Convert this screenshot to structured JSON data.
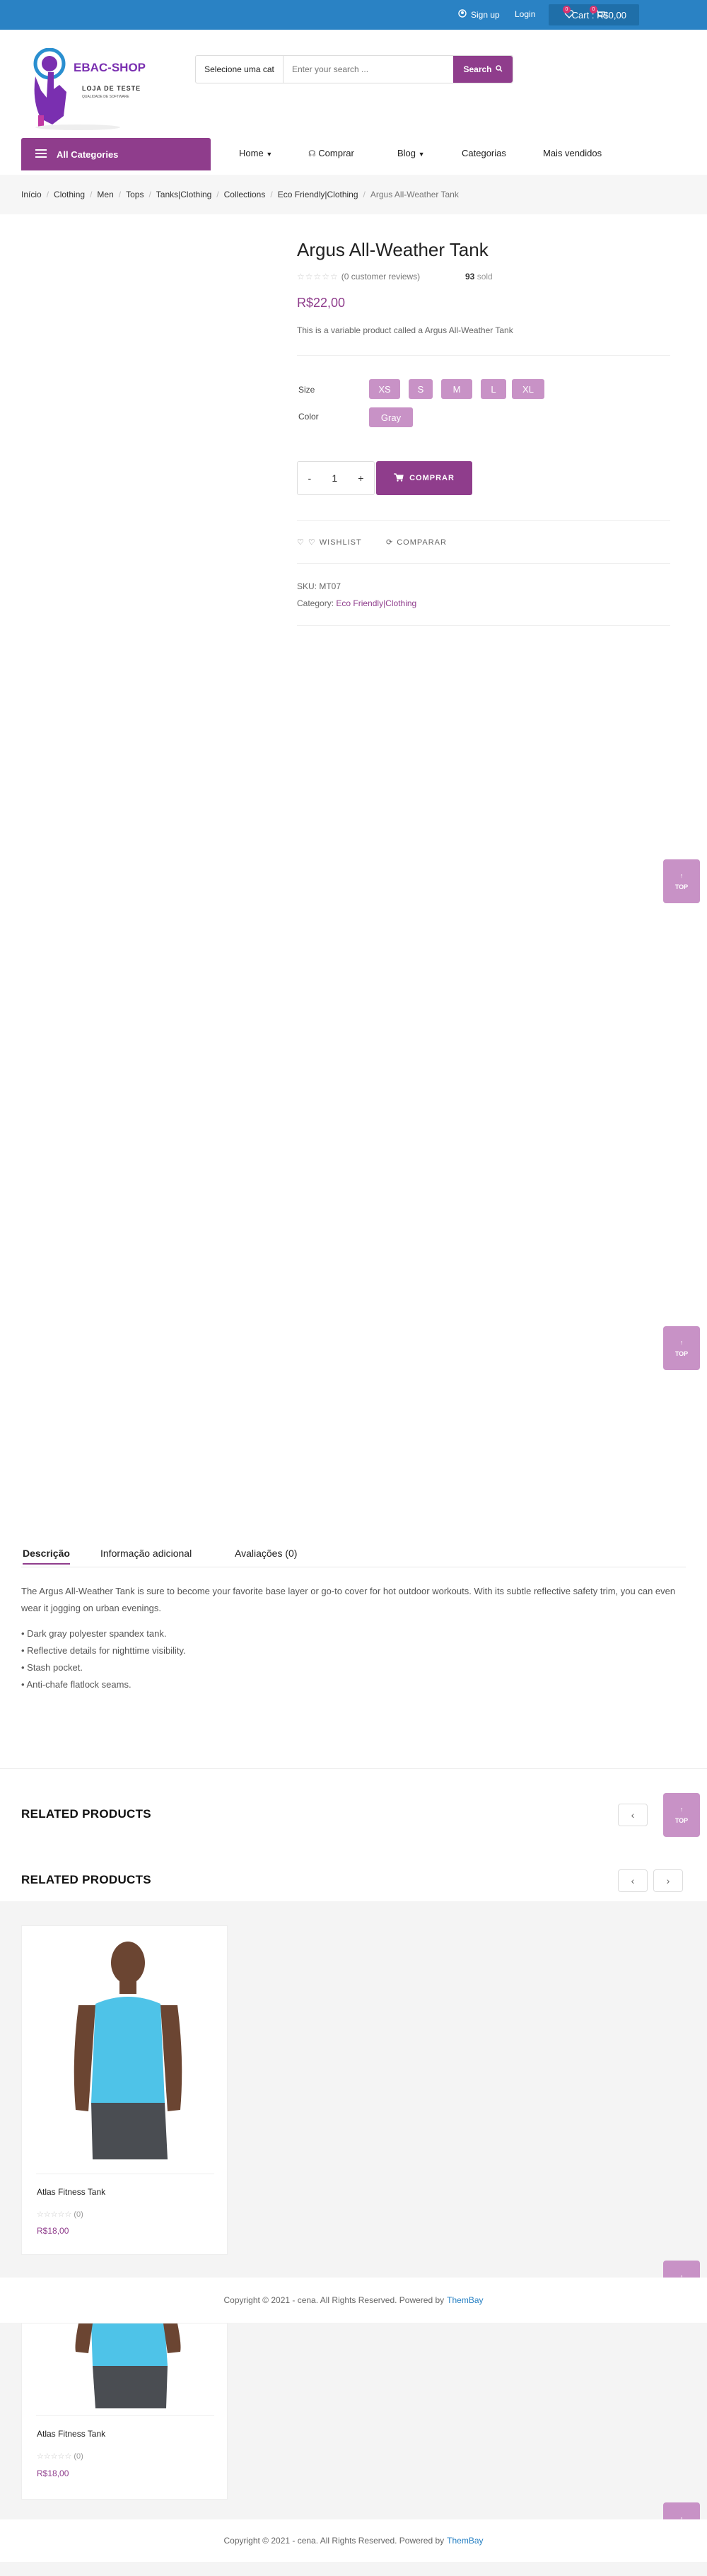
{
  "topbar": {
    "signup": "Sign up",
    "login": "Login",
    "cart_label": "Cart : R$0,00",
    "wishlist_count": "0",
    "cart_count": "0"
  },
  "logo": {
    "brand": "EBAC-SHOP",
    "tagline": "LOJA DE TESTE",
    "subtagline": "QUALIDADE DE SOFTWARE"
  },
  "search": {
    "category": "Selecione uma cat",
    "placeholder": "Enter your search ...",
    "button": "Search"
  },
  "nav": {
    "all_categories": "All Categories",
    "items": [
      "Home",
      "Comprar",
      "Blog",
      "Categorias",
      "Mais vendidos"
    ]
  },
  "breadcrumb": [
    "Início",
    "Clothing",
    "Men",
    "Tops",
    "Tanks|Clothing",
    "Collections",
    "Eco Friendly|Clothing",
    "Argus All-Weather Tank"
  ],
  "product": {
    "title": "Argus All-Weather Tank",
    "reviews": "(0 customer reviews)",
    "sold_count": "93",
    "sold_label": "sold",
    "price": "R$22,00",
    "short_description": "This is a variable product called a Argus All-Weather Tank",
    "size_label": "Size",
    "sizes": [
      "XS",
      "S",
      "M",
      "L",
      "XL"
    ],
    "color_label": "Color",
    "colors": [
      "Gray"
    ],
    "quantity": "1",
    "buy_button": "COMPRAR",
    "wishlist": "WISHLIST",
    "compare": "COMPARAR",
    "sku_label": "SKU:",
    "sku": "MT07",
    "category_label": "Category:",
    "category": "Eco Friendly|Clothing"
  },
  "totop_label": "TOP",
  "tabs": [
    "Descrição",
    "Informação adicional",
    "Avaliações (0)"
  ],
  "description": {
    "text": "The Argus All-Weather Tank is sure to become your favorite base layer or go-to cover for hot outdoor workouts. With its subtle reflective safety trim, you can even wear it jogging on urban evenings.",
    "bullets": [
      "• Dark gray polyester spandex tank.",
      "• Reflective details for nighttime visibility.",
      "• Stash pocket.",
      "• Anti-chafe flatlock seams."
    ]
  },
  "related": {
    "heading": "RELATED PRODUCTS",
    "product_name": "Atlas Fitness Tank",
    "product_reviews": "(0)",
    "product_price": "R$18,00"
  },
  "footer": {
    "text": "Copyright © 2021 - cena. All Rights Reserved. Powered by",
    "link": "ThemBay"
  },
  "colors": {
    "topbar": "#2a82c4",
    "brand": "#8f3d8c",
    "chip": "#c892c6"
  }
}
